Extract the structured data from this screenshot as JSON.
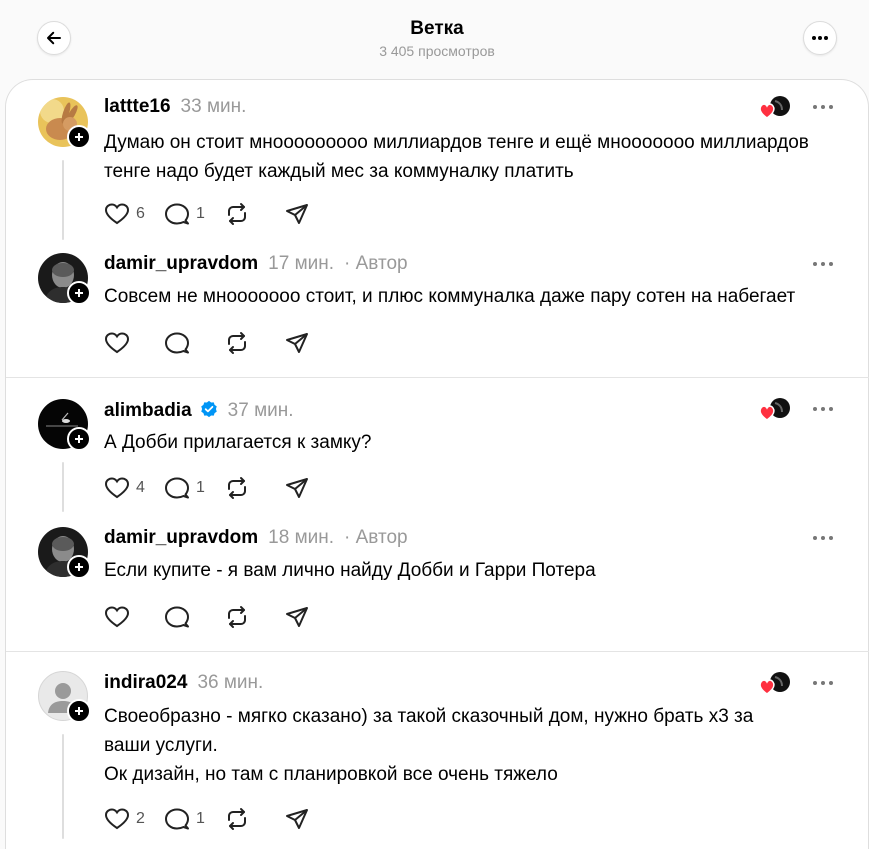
{
  "header": {
    "title": "Ветка",
    "subtitle": "3 405 просмотров",
    "back_icon": "arrow-left-icon",
    "more_icon": "more-horizontal-icon"
  },
  "threads": [
    {
      "comment": {
        "username": "lattte16",
        "time": "33 мин.",
        "text": "Думаю он стоит мнооооооооо миллиардов тенге и ещё мнооооооо миллиардов тенге надо будет каждый мес за коммуналку платить",
        "likes": "6",
        "replies": "1"
      },
      "reply": {
        "username": "damir_upravdom",
        "time": "17 мин.",
        "author": "· Автор",
        "text": "Совсем не мнооооооо стоит, и плюс коммуналка даже пару сотен на набегает"
      }
    },
    {
      "comment": {
        "username": "alimbadia",
        "time": "37 мин.",
        "text": "А Добби прилагается к замку?",
        "likes": "4",
        "replies": "1"
      },
      "reply": {
        "username": "damir_upravdom",
        "time": "18 мин.",
        "author": "· Автор",
        "text": "Если купите - я вам лично найду Добби и Гарри Потера"
      }
    },
    {
      "comment": {
        "username": "indira024",
        "time": "36 мин.",
        "text_line1": "Своеобразно - мягко сказано) за такой сказочный дом, нужно брать х3 за ваши услуги.",
        "text_line2": "Ок дизайн, но там с планировкой все очень тяжело",
        "likes": "2",
        "replies": "1"
      }
    }
  ],
  "colors": {
    "heart_red": "#ff3040",
    "verified_blue": "#0095f6",
    "muted": "#999999"
  }
}
